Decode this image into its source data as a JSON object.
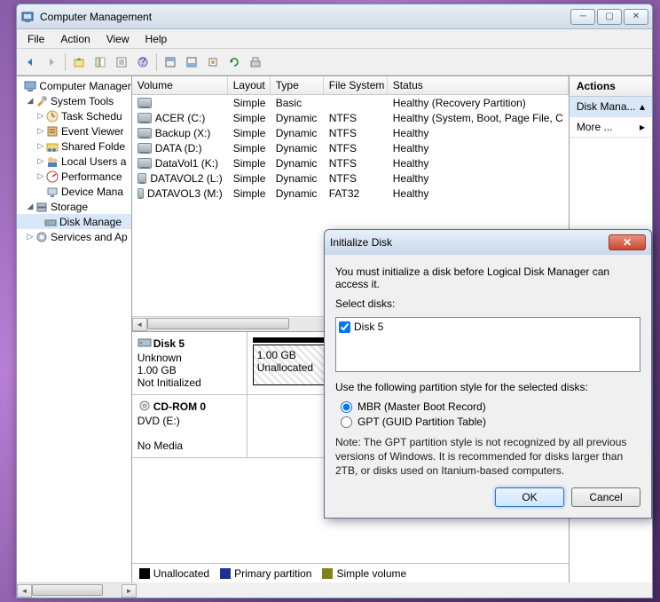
{
  "window": {
    "title": "Computer Management"
  },
  "menu": {
    "file": "File",
    "action": "Action",
    "view": "View",
    "help": "Help"
  },
  "tree": {
    "root": "Computer Manager",
    "systools": "System Tools",
    "tasksched": "Task Schedu",
    "eventviewer": "Event Viewer",
    "sharedfolders": "Shared Folde",
    "localusers": "Local Users a",
    "performance": "Performance",
    "devicemgr": "Device Mana",
    "storage": "Storage",
    "diskmgmt": "Disk Manage",
    "services": "Services and Ap"
  },
  "columns": {
    "volume": "Volume",
    "layout": "Layout",
    "type": "Type",
    "fs": "File System",
    "status": "Status"
  },
  "volumes": [
    {
      "name": "",
      "layout": "Simple",
      "type": "Basic",
      "fs": "",
      "status": "Healthy (Recovery Partition)"
    },
    {
      "name": "ACER (C:)",
      "layout": "Simple",
      "type": "Dynamic",
      "fs": "NTFS",
      "status": "Healthy (System, Boot, Page File, C"
    },
    {
      "name": "Backup (X:)",
      "layout": "Simple",
      "type": "Dynamic",
      "fs": "NTFS",
      "status": "Healthy"
    },
    {
      "name": "DATA (D:)",
      "layout": "Simple",
      "type": "Dynamic",
      "fs": "NTFS",
      "status": "Healthy"
    },
    {
      "name": "DataVol1 (K:)",
      "layout": "Simple",
      "type": "Dynamic",
      "fs": "NTFS",
      "status": "Healthy"
    },
    {
      "name": "DATAVOL2 (L:)",
      "layout": "Simple",
      "type": "Dynamic",
      "fs": "NTFS",
      "status": "Healthy"
    },
    {
      "name": "DATAVOL3 (M:)",
      "layout": "Simple",
      "type": "Dynamic",
      "fs": "FAT32",
      "status": "Healthy"
    }
  ],
  "disk5": {
    "title": "Disk 5",
    "status": "Unknown",
    "size": "1.00 GB",
    "init": "Not Initialized",
    "partsize": "1.00 GB",
    "parttype": "Unallocated"
  },
  "cdrom": {
    "title": "CD-ROM 0",
    "drive": "DVD (E:)",
    "media": "No Media"
  },
  "legend": {
    "unalloc": "Unallocated",
    "primary": "Primary partition",
    "simple": "Simple volume"
  },
  "actions": {
    "header": "Actions",
    "diskmgmt": "Disk Mana...",
    "more": "More ..."
  },
  "dialog": {
    "title": "Initialize Disk",
    "msg": "You must initialize a disk before Logical Disk Manager can access it.",
    "select": "Select disks:",
    "disk": "Disk 5",
    "partstyle": "Use the following partition style for the selected disks:",
    "mbr": "MBR (Master Boot Record)",
    "gpt": "GPT (GUID Partition Table)",
    "note": "Note: The GPT partition style is not recognized by all previous versions of Windows. It is recommended for disks larger than 2TB, or disks used on Itanium-based computers.",
    "ok": "OK",
    "cancel": "Cancel"
  }
}
